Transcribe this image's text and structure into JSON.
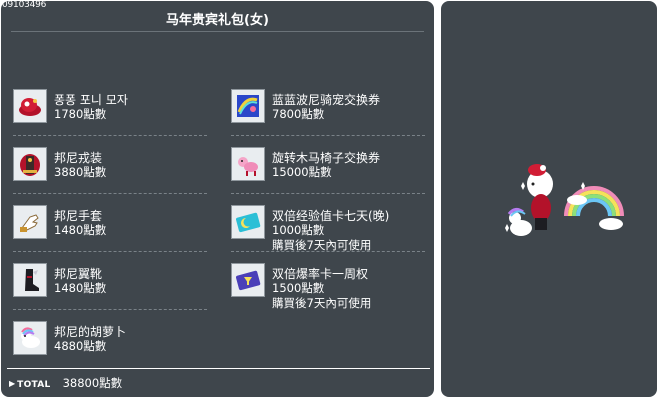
{
  "package": {
    "id": "09103496",
    "title": "马年贵宾礼包(女)"
  },
  "items_left": [
    {
      "name": "퐁퐁 포니 모자",
      "price": "1780點數",
      "icon": "pony-hat-icon"
    },
    {
      "name": "邦尼戎装",
      "price": "3880點數",
      "icon": "armor-outfit-icon"
    },
    {
      "name": "邦尼手套",
      "price": "1480點數",
      "icon": "glove-icon"
    },
    {
      "name": "邦尼翼靴",
      "price": "1480點數",
      "icon": "winged-boots-icon"
    },
    {
      "name": "邦尼的胡萝卜",
      "price": "4880點數",
      "icon": "rainbow-pony-icon"
    }
  ],
  "items_right": [
    {
      "name": "蓝蓝波尼骑宠交换券",
      "price": "7800點數",
      "icon": "mount-voucher-icon"
    },
    {
      "name": "旋转木马椅子交换券",
      "price": "15000點數",
      "icon": "carousel-chair-icon"
    },
    {
      "name": "双倍经验值卡七天(晚)",
      "price": "1000點數",
      "note": "購買後7天內可使用",
      "icon": "exp-card-icon"
    },
    {
      "name": "双倍爆率卡一周权",
      "price": "1500點數",
      "note": "購買後7天內可使用",
      "icon": "drop-card-icon"
    }
  ],
  "total": {
    "label": "TOTAL",
    "value": "38800點數"
  },
  "colors": {
    "panel_bg": "#3f464c",
    "text": "#ffffff",
    "icon_bg": "#e9edf0"
  }
}
